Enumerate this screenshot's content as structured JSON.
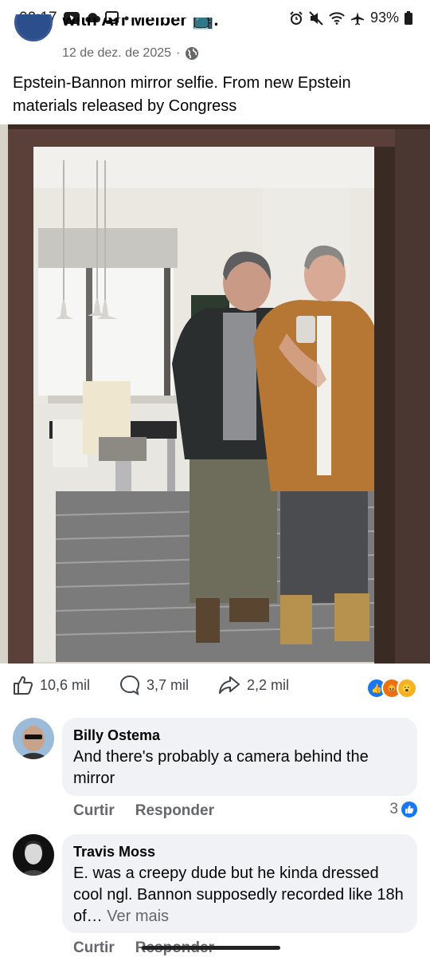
{
  "status_bar": {
    "time": "00:17",
    "battery": "93%",
    "left_icons": [
      "youtube-icon",
      "cloud-icon",
      "gallery-icon",
      "dot-icon"
    ],
    "right_icons": [
      "alarm-icon",
      "mute-icon",
      "wifi-icon",
      "airplane-icon",
      "battery-icon"
    ]
  },
  "post": {
    "author_line": "with Ari Melber 📺.",
    "date": "12 de dez. de 2025",
    "separator": "·",
    "privacy_icon": "globe-icon",
    "text": "Epstein-Bannon mirror selfie. From new Epstein materials released by Congress",
    "likes": "10,6 mil",
    "comments": "3,7 mil",
    "shares": "2,2 mil",
    "reaction_icons": [
      "like-reaction-icon",
      "angry-reaction-icon",
      "wow-reaction-icon"
    ]
  },
  "comments": [
    {
      "name": "Billy Ostema",
      "text": "And there's probably a camera behind the mirror",
      "like_label": "Curtir",
      "reply_label": "Responder",
      "reaction_count": "3"
    },
    {
      "name": "Travis Moss",
      "text": "E. was a creepy dude but he kinda dressed cool ngl. Bannon supposedly recorded like 18h of…",
      "more_label": "Ver mais",
      "like_label": "Curtir",
      "reply_label": "Responder"
    }
  ],
  "colors": {
    "facebook_blue": "#1877f2",
    "text_secondary": "#65676b",
    "bubble_bg": "#f0f2f5"
  }
}
